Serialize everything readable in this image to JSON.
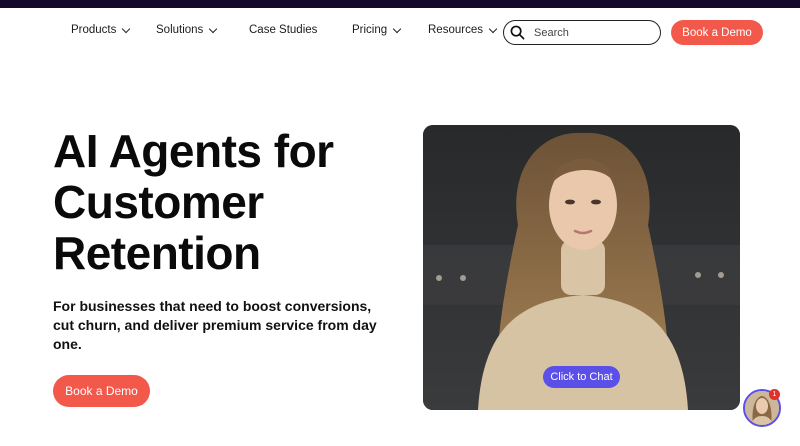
{
  "nav": {
    "items": [
      {
        "label": "Products",
        "has_dropdown": true
      },
      {
        "label": "Solutions",
        "has_dropdown": true
      },
      {
        "label": "Case Studies",
        "has_dropdown": false
      },
      {
        "label": "Pricing",
        "has_dropdown": true
      },
      {
        "label": "Resources",
        "has_dropdown": true
      }
    ],
    "search_placeholder": "Search",
    "cta_label": "Book a Demo"
  },
  "hero": {
    "title_line1": "AI Agents for",
    "title_line2": "Customer",
    "title_line3": "Retention",
    "subtitle": "For businesses that need to boost conversions, cut churn, and deliver premium service from day one.",
    "cta_label": "Book a Demo"
  },
  "video": {
    "chat_label": "Click to Chat"
  },
  "chat_widget": {
    "badge_count": "1"
  },
  "colors": {
    "accent": "#f2594b",
    "chat_button": "#5a4fe6",
    "topbar": "#14092a"
  },
  "icons": {
    "search": "search-icon",
    "dropdown": "chevron-down-icon"
  }
}
